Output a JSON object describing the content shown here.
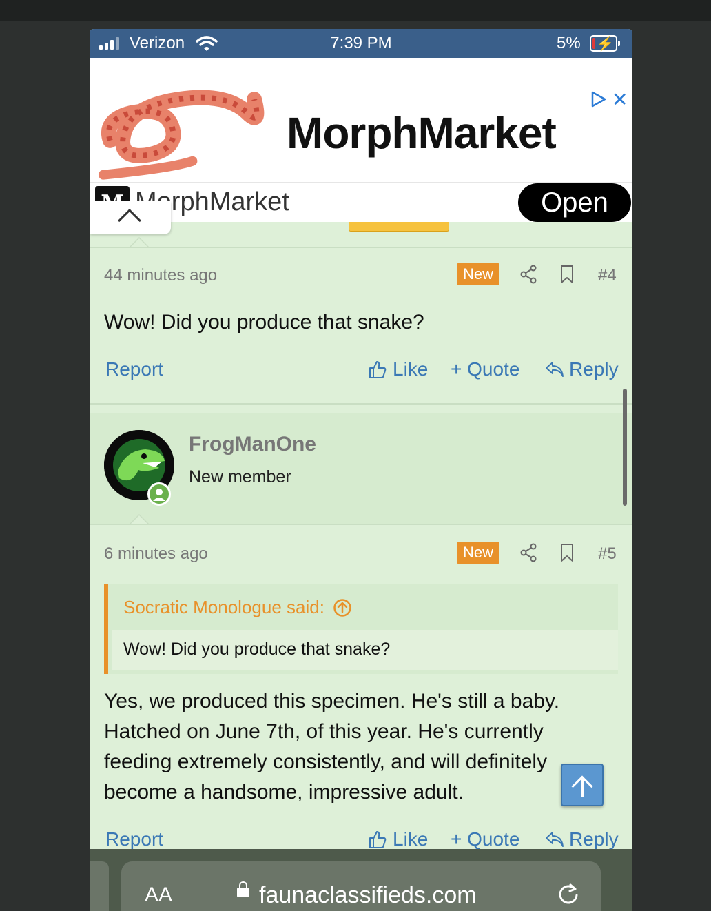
{
  "status_bar": {
    "carrier": "Verizon",
    "time": "7:39 PM",
    "battery_percent": "5%"
  },
  "ad": {
    "headline": "MorphMarket",
    "brand": "MorphMarket",
    "logo_text": "M",
    "cta": "Open"
  },
  "post4": {
    "time": "44 minutes ago",
    "badge": "New",
    "number": "#4",
    "body": "Wow! Did you produce that snake?"
  },
  "actions": {
    "report": "Report",
    "like": "Like",
    "quote": "+ Quote",
    "reply": "Reply"
  },
  "user": {
    "name": "FrogManOne",
    "title": "New member"
  },
  "post5": {
    "time": "6 minutes ago",
    "badge": "New",
    "number": "#5",
    "quote_author": "Socratic Monologue said:",
    "quote_text": "Wow! Did you produce that snake?",
    "body_lines": [
      "Yes, we produced this specimen. He's still a baby.",
      "Hatched on June 7th, of this year. He's currently",
      "feeding extremely consistently, and will definitely",
      "become a handsome, impressive adult."
    ]
  },
  "browser": {
    "text_size": "AA",
    "url": "faunaclassifieds.com"
  },
  "colors": {
    "status_bar": "#3a5f8a",
    "page_bg": "#def0d8",
    "accent_orange": "#e8912a",
    "link_blue": "#3a78b5"
  }
}
